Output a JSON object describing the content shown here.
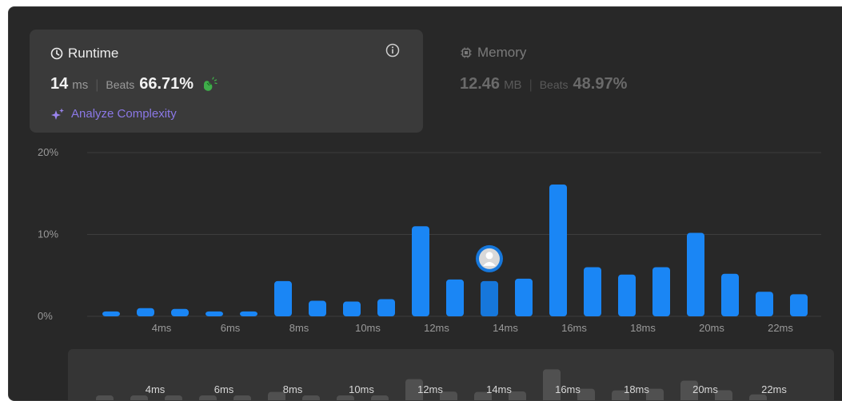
{
  "runtime": {
    "title": "Runtime",
    "value": "14",
    "unit": "ms",
    "beats_label": "Beats",
    "beats_value": "66.71%",
    "analyze_label": "Analyze Complexity"
  },
  "memory": {
    "title": "Memory",
    "value": "12.46",
    "unit": "MB",
    "beats_label": "Beats",
    "beats_value": "48.97%"
  },
  "colors": {
    "bar": "#1a86f5",
    "accent_purple": "#8b78e6",
    "clap_green": "#4caf50"
  },
  "icons": [
    "clock-icon",
    "info-icon",
    "chip-icon",
    "sparkle-icon",
    "clap-icon",
    "avatar-icon"
  ],
  "chart_data": {
    "type": "bar",
    "x": [
      3,
      4,
      5,
      6,
      7,
      8,
      9,
      10,
      11,
      12,
      13,
      14,
      15,
      16,
      17,
      18,
      19,
      20,
      21,
      22
    ],
    "values": [
      0.6,
      1.0,
      0.9,
      0.6,
      0.6,
      4.3,
      1.9,
      1.8,
      2.1,
      11.0,
      4.5,
      4.3,
      4.6,
      16.1,
      6.0,
      5.1,
      6.0,
      10.2,
      5.2,
      3.0
    ],
    "extra_bar": 2.7,
    "highlight_x": 14,
    "ylim": [
      0,
      20
    ],
    "yticks": [
      "0%",
      "10%",
      "20%"
    ],
    "ytick_values": [
      0,
      10,
      20
    ],
    "xticks": [
      "4ms",
      "6ms",
      "8ms",
      "10ms",
      "12ms",
      "14ms",
      "16ms",
      "18ms",
      "20ms",
      "22ms"
    ],
    "xtick_positions": [
      4,
      6,
      8,
      10,
      12,
      14,
      16,
      18,
      20,
      22
    ],
    "grid": true,
    "legend": "none"
  },
  "brush": {
    "ticks": [
      "4ms",
      "6ms",
      "8ms",
      "10ms",
      "12ms",
      "14ms",
      "16ms",
      "18ms",
      "20ms",
      "22ms"
    ]
  }
}
